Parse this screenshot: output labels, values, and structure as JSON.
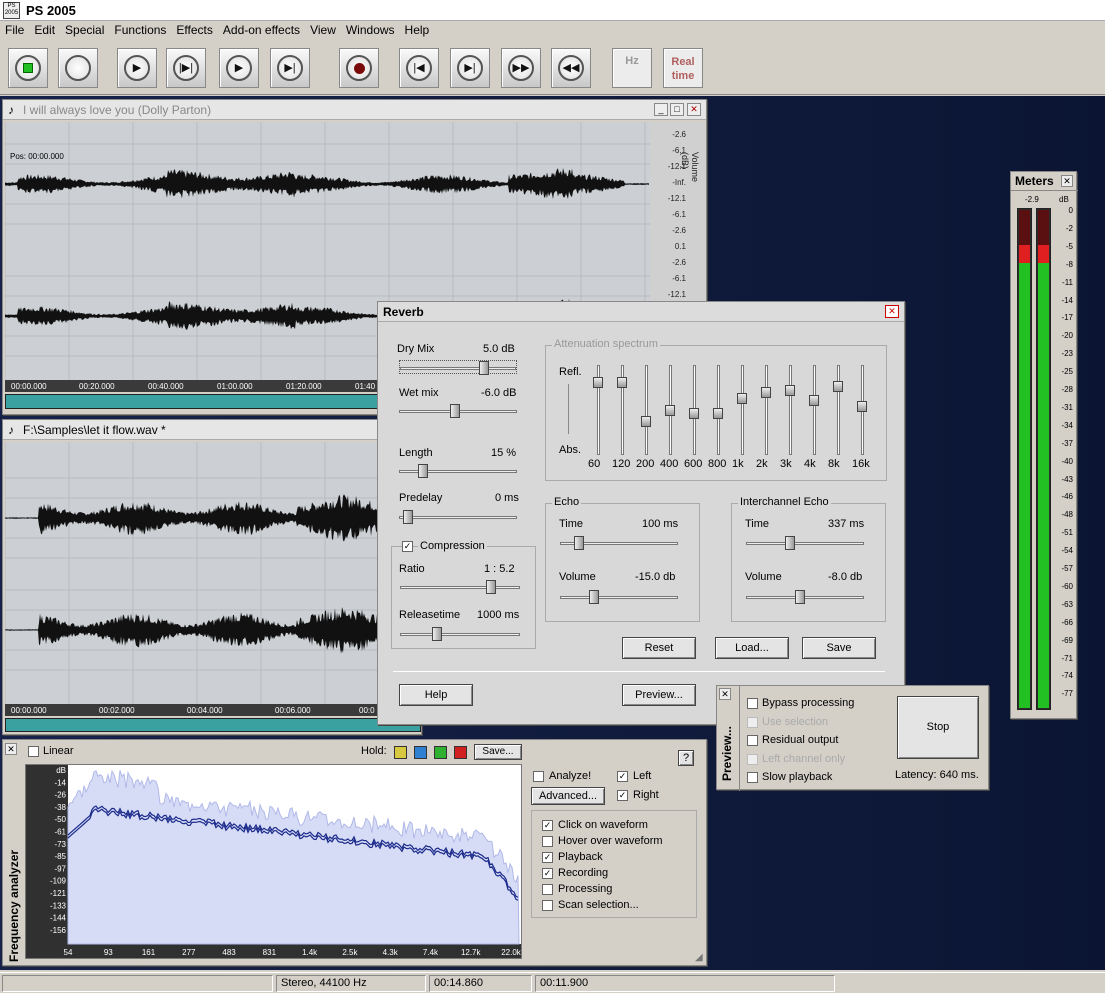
{
  "app": {
    "title": "PS 2005",
    "icon_text": "PS 2005"
  },
  "menu": [
    "File",
    "Edit",
    "Special",
    "Functions",
    "Effects",
    "Add-on effects",
    "View",
    "Windows",
    "Help"
  ],
  "toolbar": {
    "buttons": [
      {
        "name": "stop-button",
        "icon": "stop-square-icon"
      },
      {
        "name": "blank-button",
        "icon": "circle-icon"
      },
      {
        "name": "play-button",
        "icon": "play-icon"
      },
      {
        "name": "play-from-start-button",
        "icon": "play-bar-icon"
      },
      {
        "name": "play-selection-button",
        "icon": "play-icon"
      },
      {
        "name": "play-to-end-button",
        "icon": "play-end-icon"
      },
      {
        "name": "record-button",
        "icon": "record-icon"
      },
      {
        "name": "go-start-button",
        "icon": "skip-back-icon"
      },
      {
        "name": "go-end-button",
        "icon": "skip-forward-icon"
      },
      {
        "name": "fast-forward-button",
        "icon": "fast-forward-icon"
      },
      {
        "name": "rewind-button",
        "icon": "rewind-icon"
      }
    ],
    "hz_label": "Hz",
    "realtime_label": "Real time"
  },
  "wave1": {
    "title": "I will always love you (Dolly Parton)",
    "pos": "Pos: 00:00.000",
    "axis_label": "Volume (dB)",
    "db_ticks": [
      "-2.6",
      "-6.1",
      "-12.1",
      "-Inf.",
      "-12.1",
      "-6.1",
      "-2.6",
      "0.1",
      "-2.6",
      "-6.1",
      "-12.1"
    ],
    "times": [
      "00:00.000",
      "00:20.000",
      "00:40.000",
      "01:00.000",
      "01:20.000",
      "01:40"
    ]
  },
  "wave2": {
    "title": "F:\\Samples\\let it flow.wav *",
    "times": [
      "00:00.000",
      "00:02.000",
      "00:04.000",
      "00:06.000",
      "00:0"
    ]
  },
  "reverb": {
    "title": "Reverb",
    "dry_mix": {
      "label": "Dry Mix",
      "value": "5.0 dB",
      "level": 0.75
    },
    "wet_mix": {
      "label": "Wet mix",
      "value": "-6.0 dB",
      "level": 0.47
    },
    "length": {
      "label": "Length",
      "value": "15 %",
      "level": 0.15
    },
    "predelay": {
      "label": "Predelay",
      "value": "0 ms",
      "level": 0.0
    },
    "compression": {
      "label": "Compression",
      "checked": true
    },
    "ratio": {
      "label": "Ratio",
      "value": "1 : 5.2",
      "level": 0.8
    },
    "releasetime": {
      "label": "Releasetime",
      "value": "1000 ms",
      "level": 0.27
    },
    "spectrum": {
      "title": "Attenuation spectrum",
      "refl": "Refl.",
      "abs": "Abs.",
      "bands": [
        "60",
        "120",
        "200",
        "400",
        "600",
        "800",
        "1k",
        "2k",
        "3k",
        "4k",
        "8k",
        "16k"
      ],
      "levels": [
        0.85,
        0.85,
        0.35,
        0.5,
        0.45,
        0.45,
        0.65,
        0.72,
        0.75,
        0.62,
        0.8,
        0.55
      ]
    },
    "echo": {
      "title": "Echo",
      "time_label": "Time",
      "time_value": "100 ms",
      "time_level": 0.1,
      "volume_label": "Volume",
      "volume_value": "-15.0 db",
      "volume_level": 0.25
    },
    "ichecho": {
      "title": "Interchannel Echo",
      "time_label": "Time",
      "time_value": "337 ms",
      "time_level": 0.35,
      "volume_label": "Volume",
      "volume_value": "-8.0 db",
      "volume_level": 0.45
    },
    "buttons": {
      "reset": "Reset",
      "load": "Load...",
      "save": "Save",
      "help": "Help",
      "preview": "Preview..."
    }
  },
  "preview": {
    "side_label": "Preview...",
    "options": [
      {
        "label": "Bypass processing",
        "checked": false,
        "disabled": false
      },
      {
        "label": "Use selection",
        "checked": false,
        "disabled": true
      },
      {
        "label": "Residual output",
        "checked": false,
        "disabled": false
      },
      {
        "label": "Left channel only",
        "checked": false,
        "disabled": true
      },
      {
        "label": "Slow playback",
        "checked": false,
        "disabled": false
      }
    ],
    "stop": "Stop",
    "latency": "Latency: 640 ms."
  },
  "meters": {
    "title": "Meters",
    "peak": "-2.9",
    "unit": "dB",
    "scale": [
      "0",
      "-2",
      "-5",
      "-8",
      "-11",
      "-14",
      "-17",
      "-20",
      "-23",
      "-25",
      "-28",
      "-31",
      "-34",
      "-37",
      "-40",
      "-43",
      "-46",
      "-48",
      "-51",
      "-54",
      "-57",
      "-60",
      "-63",
      "-66",
      "-69",
      "-71",
      "-74",
      "-77"
    ],
    "left_level": 0.93,
    "right_level": 0.93
  },
  "analyzer": {
    "side_label": "Frequency analyzer",
    "linear": "Linear",
    "hold": "Hold:",
    "hold_colors": [
      "#d8c840",
      "#2f80d0",
      "#30b030",
      "#d02020"
    ],
    "save": "Save...",
    "help": "?",
    "analyze": "Analyze!",
    "left": "Left",
    "right": "Right",
    "advanced": "Advanced...",
    "db_scale": [
      "dB",
      "-14",
      "-26",
      "-38",
      "-50",
      "-61",
      "-73",
      "-85",
      "-97",
      "-109",
      "-121",
      "-133",
      "-144",
      "-156"
    ],
    "freqs": [
      "54",
      "93",
      "161",
      "277",
      "483",
      "831",
      "1.4k",
      "2.5k",
      "4.3k",
      "7.4k",
      "12.7k",
      "22.0k"
    ],
    "options": [
      {
        "label": "Click on waveform",
        "checked": true
      },
      {
        "label": "Hover over waveform",
        "checked": false
      },
      {
        "label": "Playback",
        "checked": true
      },
      {
        "label": "Recording",
        "checked": true
      },
      {
        "label": "Processing",
        "checked": false
      },
      {
        "label": "Scan selection...",
        "checked": false
      }
    ]
  },
  "status": [
    "",
    "Stereo, 44100 Hz",
    "00:14.860",
    "00:11.900"
  ]
}
